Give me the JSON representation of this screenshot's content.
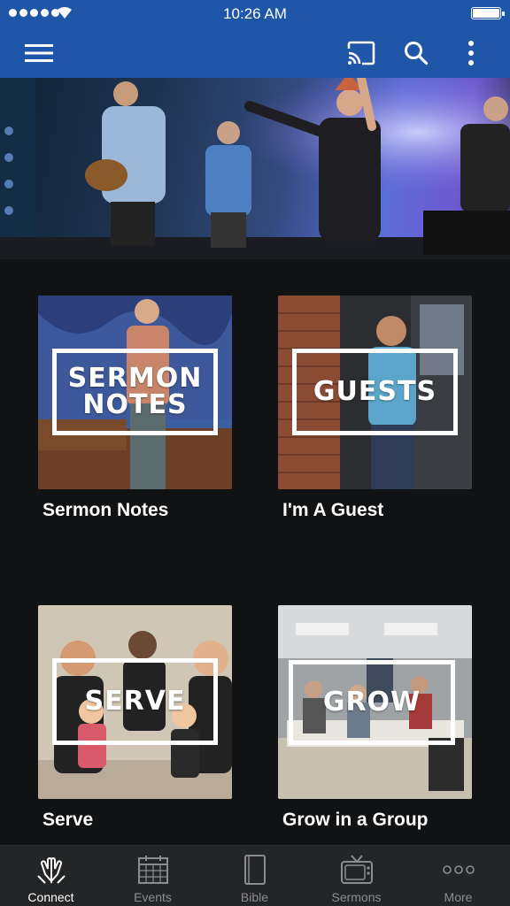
{
  "status_bar": {
    "time": "10:26 AM"
  },
  "app_bar": {
    "menu_icon": "hamburger-menu-icon",
    "cast_icon": "cast-icon",
    "search_icon": "search-icon",
    "more_icon": "kebab-menu-icon"
  },
  "tiles": [
    {
      "overlay": "SERMON\nNOTES",
      "caption": "Sermon Notes"
    },
    {
      "overlay": "GUESTS",
      "caption": "I'm A Guest"
    },
    {
      "overlay": "SERVE",
      "caption": "Serve"
    },
    {
      "overlay": "GROW",
      "caption": "Grow in a Group"
    }
  ],
  "tabs": [
    {
      "label": "Connect",
      "icon": "praying-hands-icon",
      "active": true
    },
    {
      "label": "Events",
      "icon": "calendar-icon",
      "active": false
    },
    {
      "label": "Bible",
      "icon": "book-icon",
      "active": false
    },
    {
      "label": "Sermons",
      "icon": "tv-icon",
      "active": false
    },
    {
      "label": "More",
      "icon": "ellipsis-icon",
      "active": false
    }
  ],
  "colors": {
    "primary": "#1f56a8",
    "background": "#111213",
    "tabbar": "#242526",
    "tab_inactive": "#8c8d8f"
  }
}
